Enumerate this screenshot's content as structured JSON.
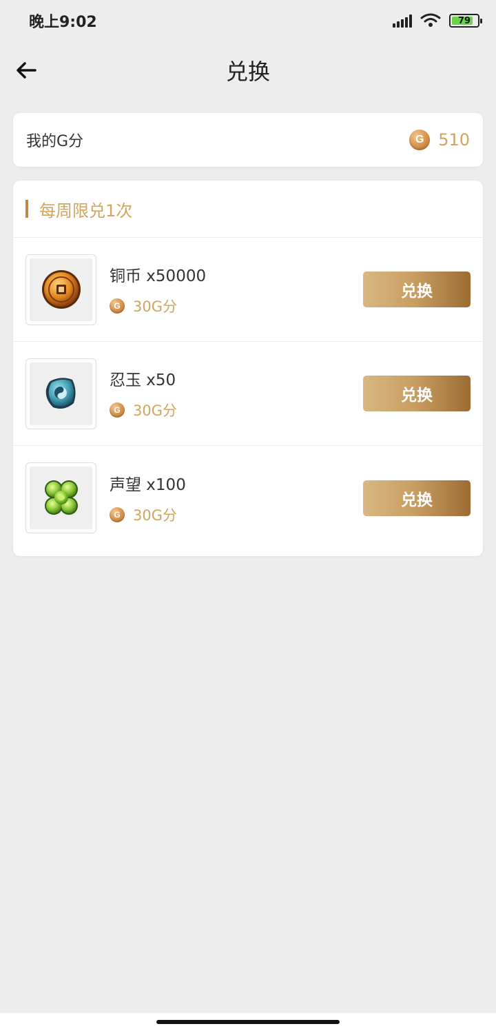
{
  "status_bar": {
    "time": "晚上9:02",
    "battery": "79"
  },
  "header": {
    "title": "兑换"
  },
  "balance": {
    "label": "我的G分",
    "coin_letter": "G",
    "value": "510"
  },
  "section": {
    "title": "每周限兑1次"
  },
  "items": [
    {
      "name": "铜币 x50000",
      "cost": "30G分",
      "button": "兑换",
      "coin_letter": "G",
      "icon": "copper-coin-icon"
    },
    {
      "name": "忍玉 x50",
      "cost": "30G分",
      "button": "兑换",
      "coin_letter": "G",
      "icon": "ninja-jade-icon"
    },
    {
      "name": "声望 x100",
      "cost": "30G分",
      "button": "兑换",
      "coin_letter": "G",
      "icon": "reputation-clover-icon"
    }
  ],
  "colors": {
    "accent": "#d2a55e",
    "button_start": "#d9b883",
    "button_end": "#9c6b33"
  }
}
